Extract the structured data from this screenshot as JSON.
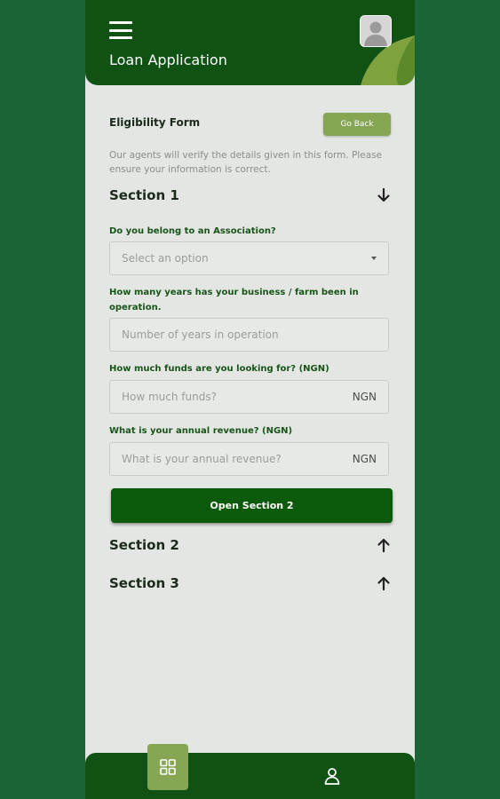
{
  "header": {
    "title": "Loan Application"
  },
  "form": {
    "title": "Eligibility Form",
    "go_back_label": "Go Back",
    "intro": "Our agents will verify the details given in this form. Please ensure your information is correct."
  },
  "sections": [
    {
      "title": "Section 1",
      "state": "expanded",
      "icon": "arrow-down-icon"
    },
    {
      "title": "Section 2",
      "state": "collapsed",
      "icon": "arrow-up-icon"
    },
    {
      "title": "Section 3",
      "state": "collapsed",
      "icon": "arrow-up-icon"
    }
  ],
  "questions": {
    "association": {
      "label": "Do you belong to an Association?",
      "placeholder": "Select an option"
    },
    "years": {
      "label": "How many years has your business / farm been in operation.",
      "placeholder": "Number of years in operation"
    },
    "funds": {
      "label": "How much funds are you looking for? (NGN)",
      "placeholder": "How much funds?",
      "suffix": "NGN"
    },
    "revenue": {
      "label": "What is your annual revenue? (NGN)",
      "placeholder": "What is your annual revenue?",
      "suffix": "NGN"
    }
  },
  "open_section_label": "Open Section 2",
  "bottom_nav": {
    "items": [
      "grid-icon",
      "user-icon"
    ]
  },
  "colors": {
    "primary": "#0c5a0c",
    "accent": "#86a653",
    "background": "#1a6436"
  }
}
